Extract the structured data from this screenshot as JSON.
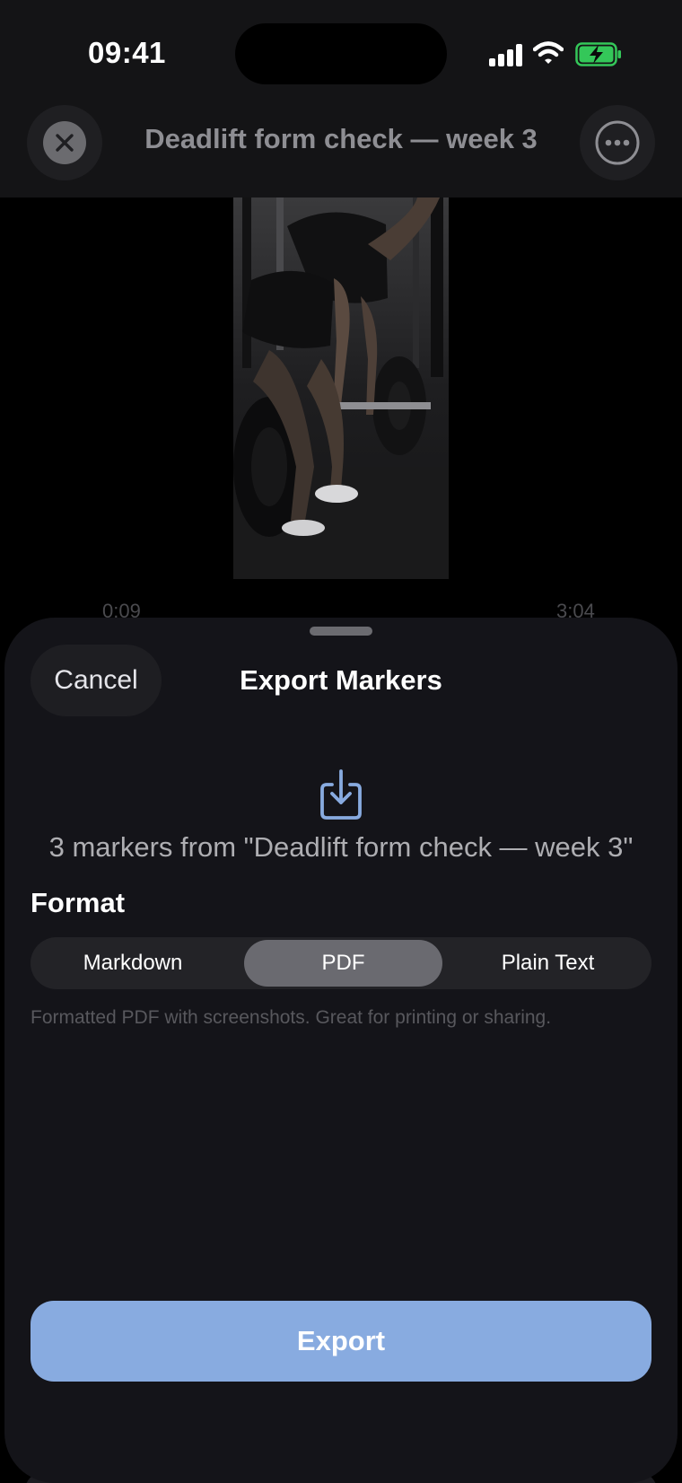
{
  "status_bar": {
    "time": "09:41"
  },
  "top_bar": {
    "title": "Deadlift form check — week 3"
  },
  "video": {
    "time_start": "0:09",
    "time_end": "3:04"
  },
  "export_sheet": {
    "cancel_label": "Cancel",
    "title": "Export Markers",
    "summary": "3 markers from \"Deadlift form check — week 3\"",
    "format_label": "Format",
    "formats": [
      {
        "label": "Markdown",
        "selected": false
      },
      {
        "label": "PDF",
        "selected": true
      },
      {
        "label": "Plain Text",
        "selected": false
      }
    ],
    "format_description": "Formatted PDF with screenshots. Great for printing or sharing.",
    "export_label": "Export"
  },
  "colors": {
    "accent": "#88abe0",
    "battery_charging": "#34c759",
    "sheet_background": "#141419"
  }
}
